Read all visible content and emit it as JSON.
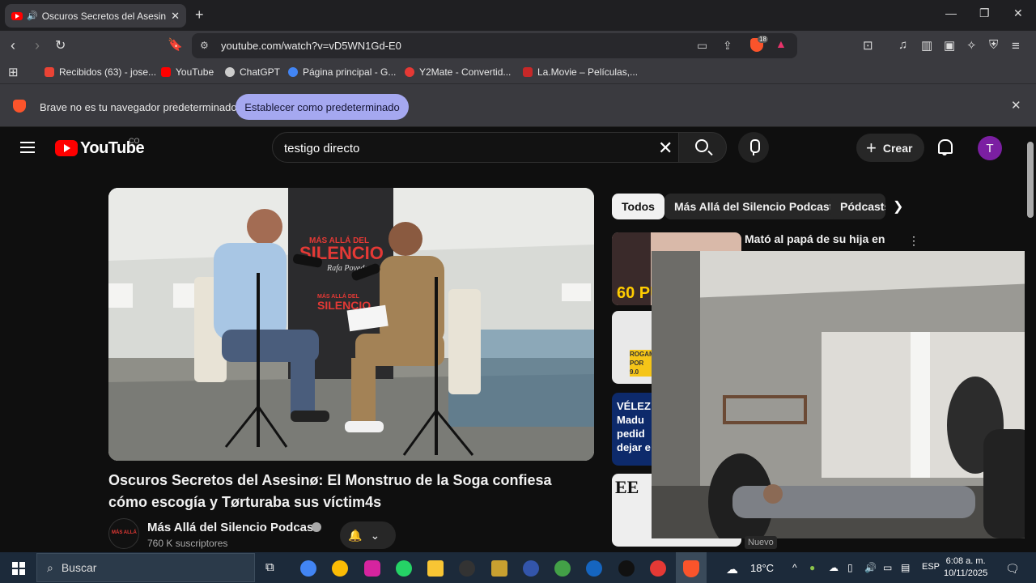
{
  "browser": {
    "tab_title": "Oscuros Secretos del Asesin",
    "url": "youtube.com/watch?v=vD5WN1Gd-E0",
    "shield_count": "18",
    "bookmarks": [
      {
        "label": "Recibidos (63) - jose...",
        "color": "#ea4335"
      },
      {
        "label": "YouTube",
        "color": "#ff0000"
      },
      {
        "label": "ChatGPT",
        "color": "#cccccc"
      },
      {
        "label": "Página principal - G...",
        "color": "#4285f4"
      },
      {
        "label": "Y2Mate - Convertid...",
        "color": "#e53935"
      },
      {
        "label": "La.Movie – Películas,...",
        "color": "#c62828"
      }
    ],
    "infobar": {
      "text": "Brave no es tu navegador predeterminado",
      "button": "Establecer como predeterminado"
    }
  },
  "youtube": {
    "logo_text": "YouTube",
    "country": "CO",
    "search_value": "testigo directo",
    "create_label": "Crear",
    "avatar_letter": "T",
    "video_title": "Oscuros Secretos del Asesinø: El Monstruo de la Soga confiesa cómo escogía y Tørturaba sus víctim4s",
    "channel_name": "Más Allá del Silencio Podcast",
    "subscribers": "760 K suscriptores",
    "chips": [
      "Todos",
      "Más Allá del Silencio Podcast",
      "Pódcasts"
    ],
    "recommendations": [
      {
        "title": "Mató al papá de su hija en",
        "thumb_text": "60 PU"
      },
      {
        "title": "",
        "thumb_text": "ROGAMO POR 9.0"
      },
      {
        "title": "",
        "thumb_text": "VÉLEZ Madu pedid dejar e"
      },
      {
        "title": "",
        "thumb_text": "EE"
      }
    ],
    "new_badge": "Nuevo",
    "thumbnail_text": {
      "brand_line1": "MÁS ALLÁ DEL",
      "brand_line2": "SILENCIO",
      "brand_sig": "Rafa Poveda"
    }
  },
  "taskbar": {
    "search_placeholder": "Buscar",
    "weather": "18°C",
    "language": "ESP",
    "time": "6:08 a. m.",
    "date": "10/11/2025"
  },
  "colors": {
    "accent_red": "#ff0000",
    "brave_orange": "#fb542b",
    "avatar_purple": "#7b1fa2",
    "infobar_button": "#a5a8f0"
  }
}
